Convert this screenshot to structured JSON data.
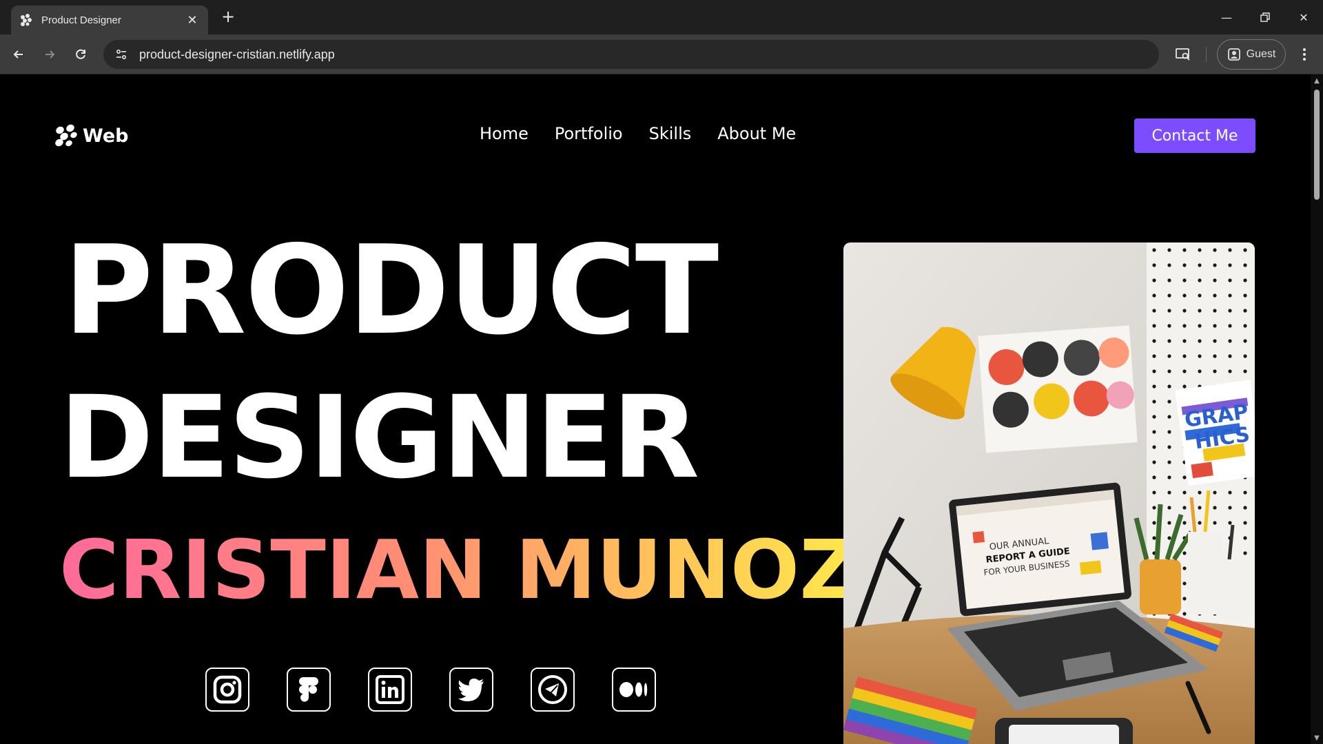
{
  "browser": {
    "tab_title": "Product Designer",
    "new_tab_icon": "plus-icon",
    "url": "product-designer-cristian.netlify.app",
    "profile_label": "Guest"
  },
  "site": {
    "logo_text": "Web",
    "nav": [
      "Home",
      "Portfolio",
      "Skills",
      "About Me"
    ],
    "contact_label": "Contact Me",
    "accent_color": "#7c4dff"
  },
  "hero": {
    "line1": "PRODUCT",
    "line2": "DESIGNER",
    "line3": "CRISTIAN MUNOZ",
    "gradient_colors": [
      "#ff6a9a",
      "#ff8f73",
      "#ffc35a",
      "#ffe84a"
    ]
  },
  "social_icons": [
    "instagram-icon",
    "figma-icon",
    "linkedin-icon",
    "twitter-icon",
    "telegram-icon",
    "medium-icon"
  ]
}
